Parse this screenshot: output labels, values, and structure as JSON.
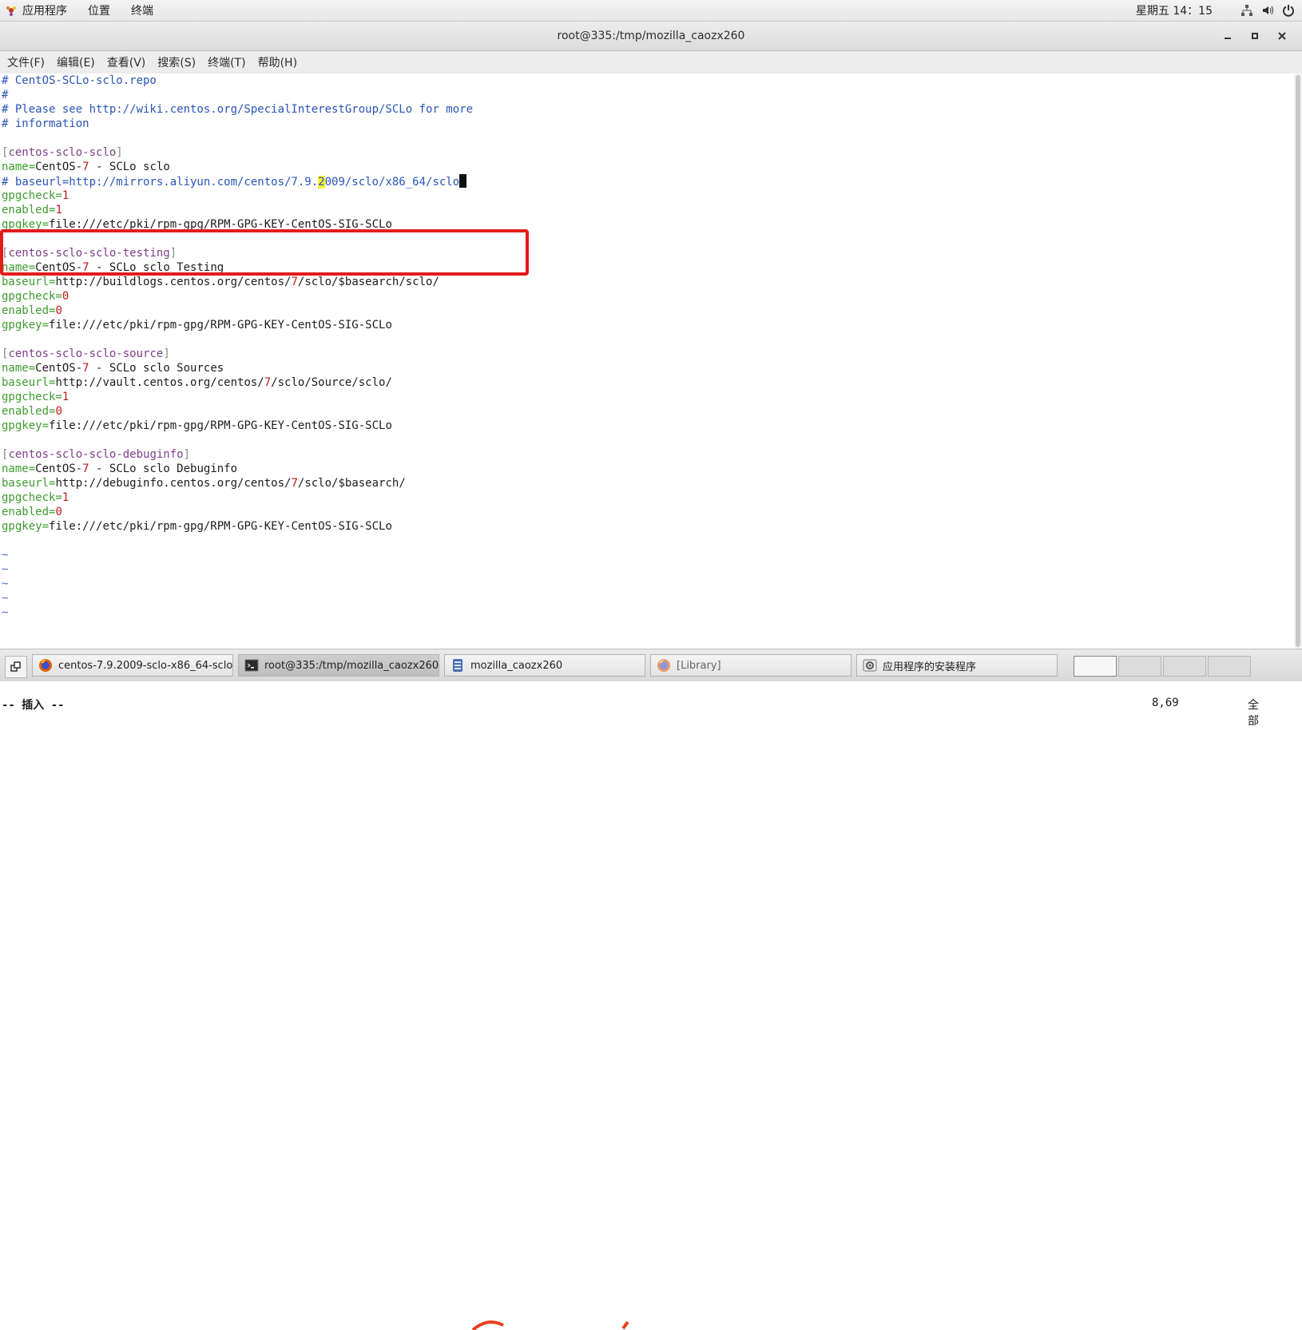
{
  "top_panel": {
    "apps_label": "应用程序",
    "places_label": "位置",
    "terminal_label": "终端",
    "clock": "星期五 14：15"
  },
  "window": {
    "title": "root@335:/tmp/mozilla_caozx260"
  },
  "menubar": {
    "items": [
      "文件(F)",
      "编辑(E)",
      "查看(V)",
      "搜索(S)",
      "终端(T)",
      "帮助(H)"
    ]
  },
  "file_lines": [
    "# CentOS-SCLo-sclo.repo",
    "#",
    "# Please see http://wiki.centos.org/SpecialInterestGroup/SCLo for more",
    "# information",
    "",
    "[centos-sclo-sclo]",
    "name=CentOS-7 - SCLo sclo",
    "# baseurl=http://mirrors.aliyun.com/centos/7.9.2009/sclo/x86_64/sclo",
    "gpgcheck=1",
    "enabled=1",
    "gpgkey=file:///etc/pki/rpm-gpg/RPM-GPG-KEY-CentOS-SIG-SCLo",
    "",
    "[centos-sclo-sclo-testing]",
    "name=CentOS-7 - SCLo sclo Testing",
    "baseurl=http://buildlogs.centos.org/centos/7/sclo/$basearch/sclo/",
    "gpgcheck=0",
    "enabled=0",
    "gpgkey=file:///etc/pki/rpm-gpg/RPM-GPG-KEY-CentOS-SIG-SCLo",
    "",
    "[centos-sclo-sclo-source]",
    "name=CentOS-7 - SCLo sclo Sources",
    "baseurl=http://vault.centos.org/centos/7/sclo/Source/sclo/",
    "gpgcheck=1",
    "enabled=0",
    "gpgkey=file:///etc/pki/rpm-gpg/RPM-GPG-KEY-CentOS-SIG-SCLo",
    "",
    "[centos-sclo-sclo-debuginfo]",
    "name=CentOS-7 - SCLo sclo Debuginfo",
    "baseurl=http://debuginfo.centos.org/centos/7/sclo/$basearch/",
    "gpgcheck=1",
    "enabled=0",
    "gpgkey=file:///etc/pki/rpm-gpg/RPM-GPG-KEY-CentOS-SIG-SCLo",
    "",
    "~",
    "~",
    "~",
    "~",
    "~"
  ],
  "status": {
    "mode": "-- 插入 --",
    "position": "8,69",
    "scroll": "全部"
  },
  "taskbar": {
    "tasks": [
      {
        "label": "centos-7.9.2009-sclo-x86_64-sclo...",
        "icon": "firefox-icon"
      },
      {
        "label": "root@335:/tmp/mozilla_caozx260",
        "icon": "terminal-icon"
      },
      {
        "label": "mozilla_caozx260",
        "icon": "file-manager-icon"
      },
      {
        "label": "[Library]",
        "icon": "firefox-icon"
      },
      {
        "label": "应用程序的安装程序",
        "icon": "installer-icon"
      }
    ]
  },
  "colors": {
    "comment": "#2a55b7",
    "key": "#3e9b2f",
    "number": "#c21a1a",
    "section": "#7d3d8a",
    "annotation_box": "#e31b1b",
    "search_highlight": "#f4f032"
  }
}
